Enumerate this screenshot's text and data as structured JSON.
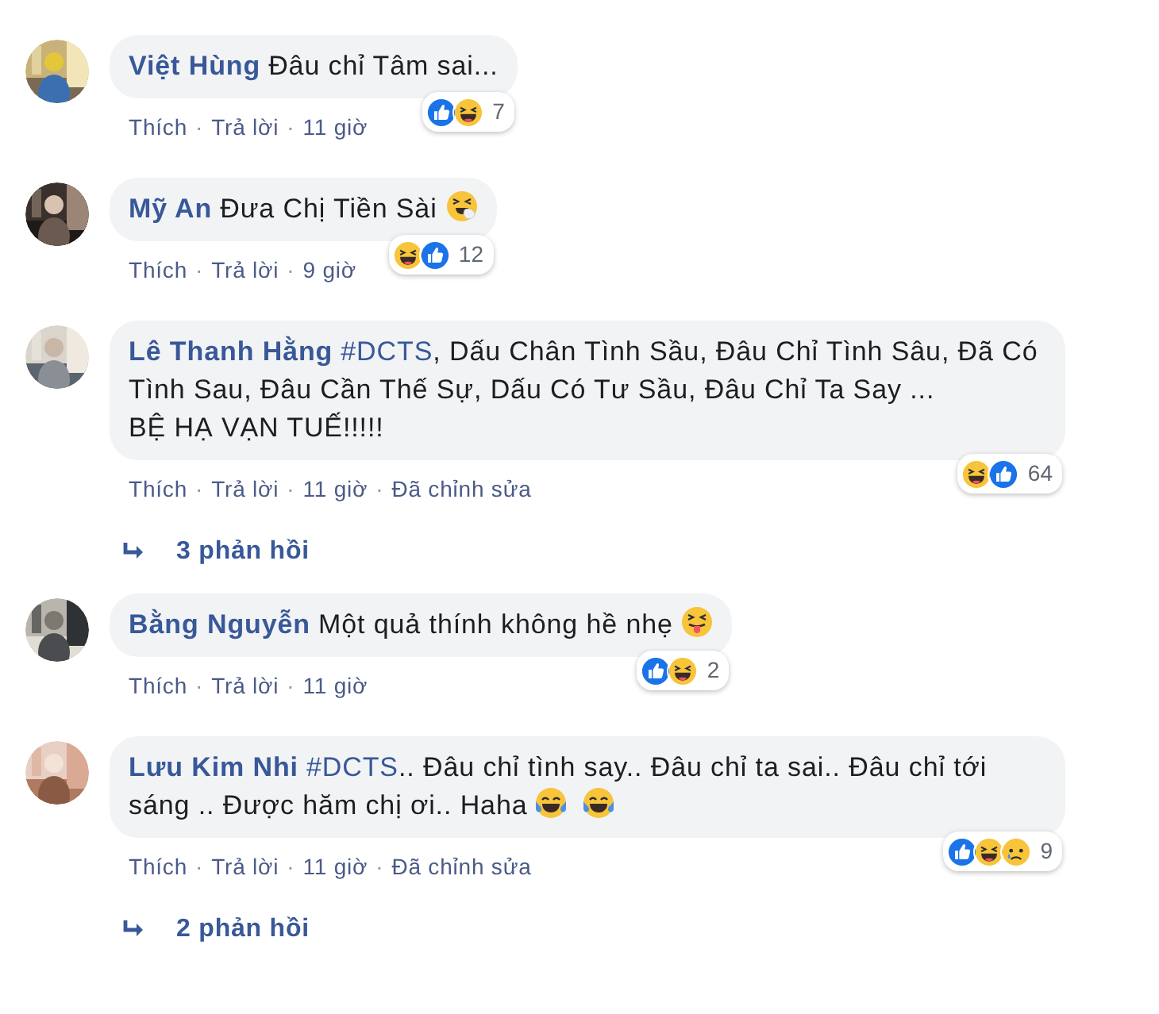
{
  "separator": "·",
  "comments": [
    {
      "author": "Việt Hùng",
      "body": [
        {
          "kind": "text",
          "text": "Đâu chỉ Tâm sai..."
        }
      ],
      "reactions": {
        "icons": [
          {
            "kind": "like"
          },
          {
            "kind": "haha"
          }
        ],
        "count": "7"
      },
      "actions": [
        "Thích",
        "Trả lời",
        "11 giờ"
      ]
    },
    {
      "author": "Mỹ An",
      "body": [
        {
          "kind": "text",
          "text": "Đưa Chị Tiền Sài "
        },
        {
          "kind": "sneeze"
        }
      ],
      "reactions": {
        "icons": [
          {
            "kind": "haha"
          },
          {
            "kind": "like"
          }
        ],
        "count": "12"
      },
      "actions": [
        "Thích",
        "Trả lời",
        "9 giờ"
      ]
    },
    {
      "author": "Lê Thanh Hằng",
      "body": [
        {
          "kind": "hashtag",
          "text": "#DCTS"
        },
        {
          "kind": "text",
          "text": ", Dấu Chân Tình Sầu, Đâu Chỉ Tình Sâu, Đã Có Tình Sau, Đâu Cần Thế Sự, Dấu Có Tư Sầu, Đâu Chỉ Ta Say ...\nBỆ HẠ VẠN TUẾ!!!!!"
        }
      ],
      "reactions": {
        "icons": [
          {
            "kind": "haha"
          },
          {
            "kind": "like"
          }
        ],
        "count": "64"
      },
      "actions": [
        "Thích",
        "Trả lời",
        "11 giờ",
        "Đã chỉnh sửa"
      ],
      "replies": "3 phản hồi"
    },
    {
      "author": "Bằng Nguyễn",
      "body": [
        {
          "kind": "text",
          "text": "Một quả thính không hề nhẹ "
        },
        {
          "kind": "tongue"
        }
      ],
      "reactions": {
        "icons": [
          {
            "kind": "like"
          },
          {
            "kind": "haha"
          }
        ],
        "count": "2"
      },
      "actions": [
        "Thích",
        "Trả lời",
        "11 giờ"
      ]
    },
    {
      "author": "Lưu Kim Nhi",
      "body": [
        {
          "kind": "hashtag",
          "text": "#DCTS"
        },
        {
          "kind": "text",
          "text": ".. Đâu chỉ tình say.. Đâu chỉ ta sai.. Đâu chỉ tới sáng .. Được hăm chị ơi.. Haha "
        },
        {
          "kind": "tears"
        },
        {
          "kind": "tears"
        }
      ],
      "reactions": {
        "icons": [
          {
            "kind": "like"
          },
          {
            "kind": "haha"
          },
          {
            "kind": "sad"
          }
        ],
        "count": "9"
      },
      "actions": [
        "Thích",
        "Trả lời",
        "11 giờ",
        "Đã chỉnh sửa"
      ],
      "replies": "2 phản hồi"
    }
  ]
}
